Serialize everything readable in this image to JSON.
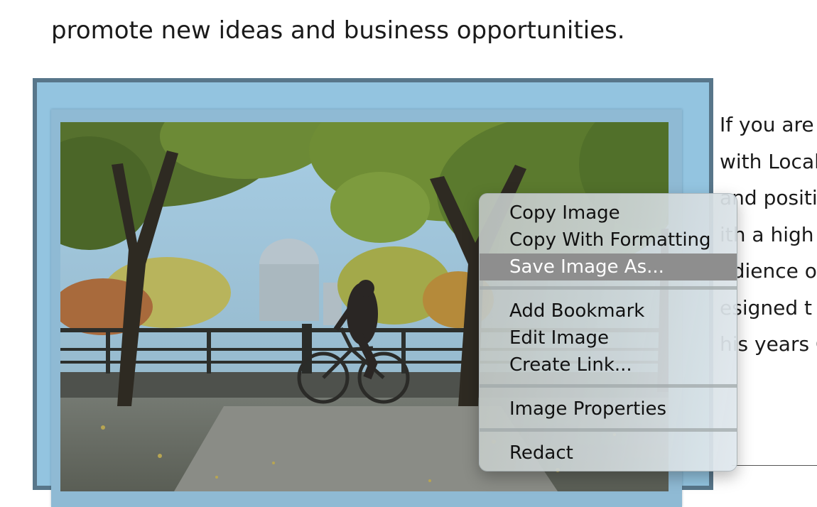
{
  "article": {
    "intro_line": "promote new ideas and business opportunities.",
    "side_lines": [
      "If you are l",
      "with Local,",
      "and positio",
      "ith a high",
      "udience o",
      "esigned t",
      "his years C"
    ]
  },
  "image": {
    "alt": "Cyclist riding along a tree-lined waterfront path"
  },
  "context_menu": {
    "items": [
      {
        "label": "Copy Image"
      },
      {
        "label": "Copy With Formatting"
      },
      {
        "label": "Save Image As...",
        "highlighted": true
      },
      {
        "label": "Add Bookmark"
      },
      {
        "label": "Edit Image"
      },
      {
        "label": "Create Link..."
      },
      {
        "label": "Image Properties"
      },
      {
        "label": "Redact"
      }
    ]
  },
  "colors": {
    "frame_border": "#58768a",
    "frame_background": "#93c4e0",
    "menu_highlight": "#8e8e8e"
  }
}
